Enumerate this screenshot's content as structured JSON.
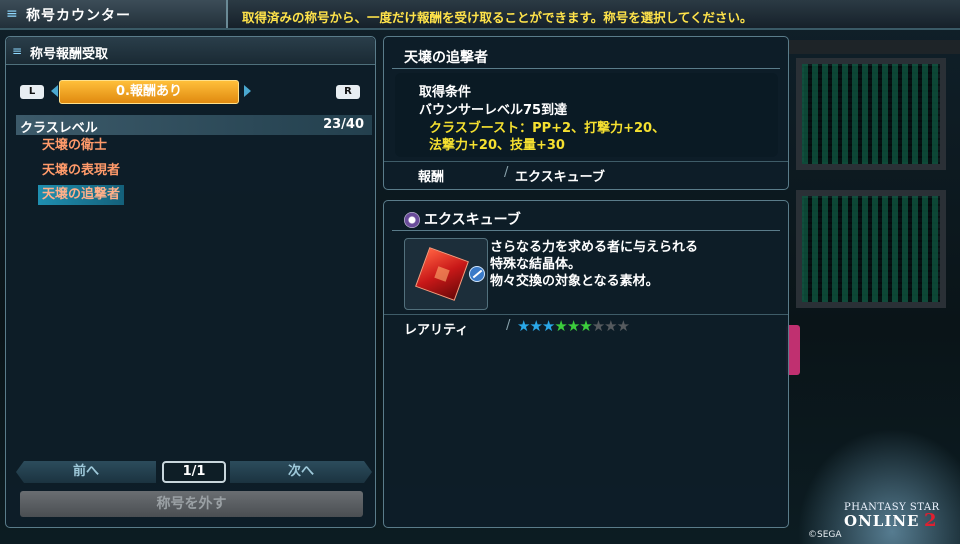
{
  "top_bar": {
    "title": "称号カウンター",
    "notice": "取得済みの称号から、一度だけ報酬を受け取ることができます。称号を選択してください。"
  },
  "left_panel": {
    "header": "称号報酬受取",
    "l_button": "L",
    "r_button": "R",
    "active_tab": "0.報酬あり",
    "category": {
      "name": "クラスレベル",
      "count": "23/40"
    },
    "titles": [
      {
        "label": "天壌の衛士",
        "selected": false
      },
      {
        "label": "天壌の表現者",
        "selected": false
      },
      {
        "label": "天壌の追撃者",
        "selected": true
      }
    ],
    "pager": {
      "prev": "前へ",
      "page": "1/1",
      "next": "次へ"
    },
    "remove_button": "称号を外す"
  },
  "detail_panel": {
    "title": "天壌の追撃者",
    "condition_label": "取得条件",
    "condition_value": "バウンサーレベル75到達",
    "boost_line1": "クラスブースト：PP+2、打撃力+20、",
    "boost_line2": "法撃力+20、技量+30",
    "reward_label": "報酬",
    "separator": "/",
    "reward_value": "エクスキューブ"
  },
  "item_panel": {
    "name": "エクスキューブ",
    "description": [
      "さらなる力を求める者に与えられる",
      "特殊な結晶体。",
      "物々交換の対象となる素材。"
    ],
    "rarity_label": "レアリティ",
    "separator": "/",
    "rarity_stars": {
      "filled": 6,
      "total": 9
    }
  },
  "logo": {
    "line1": "PHANTASY STAR",
    "line2": "ONLINE",
    "line3": "2"
  },
  "copyright": "©SEGA",
  "colors": {
    "notice": "#ffe34a",
    "active_tab": "#f0a020",
    "title_item": "#ff9a6a",
    "selected_row": "#1f8fb0",
    "boost_text": "#f5e030",
    "star_blue": "#2aa8e8",
    "star_green": "#3ccd3c",
    "star_empty": "#555a5e"
  }
}
